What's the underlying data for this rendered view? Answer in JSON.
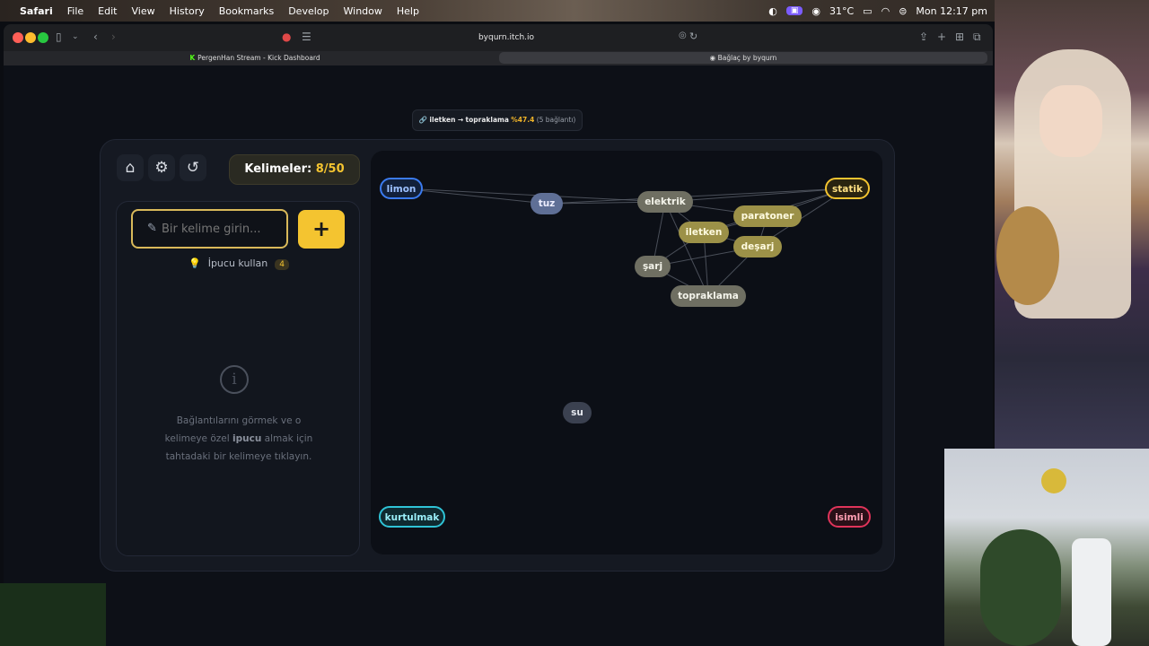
{
  "menubar": {
    "app": "Safari",
    "items": [
      "File",
      "Edit",
      "View",
      "History",
      "Bookmarks",
      "Develop",
      "Window",
      "Help"
    ],
    "temperature": "31°C",
    "clock": "Mon 12:17 pm"
  },
  "browser": {
    "url": "byqurn.itch.io",
    "tabs": [
      {
        "label": "PergenHan Stream - Kick Dashboard"
      },
      {
        "label": "Bağlaç by byqurn"
      }
    ]
  },
  "route": {
    "from": "iletken",
    "arrow": "→",
    "to": "topraklama",
    "percent": "%47.4",
    "connections": "(5 bağlantı)"
  },
  "counter": {
    "label": "Kelimeler:",
    "value": "8/50"
  },
  "input": {
    "placeholder": "Bir kelime girin...",
    "add_label": "+"
  },
  "hint": {
    "label": "İpucu kullan",
    "count": "4"
  },
  "info": {
    "line1": "Bağlantılarını görmek ve o",
    "line2a": "kelimeye özel ",
    "line2b": "ipucu",
    "line2c": " almak için",
    "line3": "tahtadaki bir kelimeye tıklayın."
  },
  "board": {
    "words": [
      {
        "id": "limon",
        "label": "limon",
        "style": "outline-blue"
      },
      {
        "id": "tuz",
        "label": "tuz",
        "style": "slate"
      },
      {
        "id": "elektrik",
        "label": "elektrik",
        "style": "gray"
      },
      {
        "id": "statik",
        "label": "statik",
        "style": "outline-yellow"
      },
      {
        "id": "paratoner",
        "label": "paratoner",
        "style": "gold"
      },
      {
        "id": "iletken",
        "label": "iletken",
        "style": "gold"
      },
      {
        "id": "desarj",
        "label": "deşarj",
        "style": "gold"
      },
      {
        "id": "sarj",
        "label": "şarj",
        "style": "gray"
      },
      {
        "id": "topraklama",
        "label": "topraklama",
        "style": "gray"
      },
      {
        "id": "su",
        "label": "su",
        "style": "dark"
      },
      {
        "id": "kurtulmak",
        "label": "kurtulmak",
        "style": "outline-cyan"
      },
      {
        "id": "isimli",
        "label": "isimli",
        "style": "outline-red"
      }
    ],
    "edges": [
      [
        "limon",
        "tuz"
      ],
      [
        "limon",
        "elektrik"
      ],
      [
        "tuz",
        "elektrik"
      ],
      [
        "tuz",
        "statik"
      ],
      [
        "elektrik",
        "statik"
      ],
      [
        "elektrik",
        "iletken"
      ],
      [
        "elektrik",
        "sarj"
      ],
      [
        "elektrik",
        "paratoner"
      ],
      [
        "elektrik",
        "topraklama"
      ],
      [
        "statik",
        "paratoner"
      ],
      [
        "statik",
        "iletken"
      ],
      [
        "statik",
        "desarj"
      ],
      [
        "iletken",
        "sarj"
      ],
      [
        "iletken",
        "topraklama"
      ],
      [
        "iletken",
        "desarj"
      ],
      [
        "paratoner",
        "desarj"
      ],
      [
        "sarj",
        "desarj"
      ],
      [
        "sarj",
        "topraklama"
      ],
      [
        "desarj",
        "topraklama"
      ],
      [
        "paratoner",
        "iletken"
      ]
    ]
  }
}
